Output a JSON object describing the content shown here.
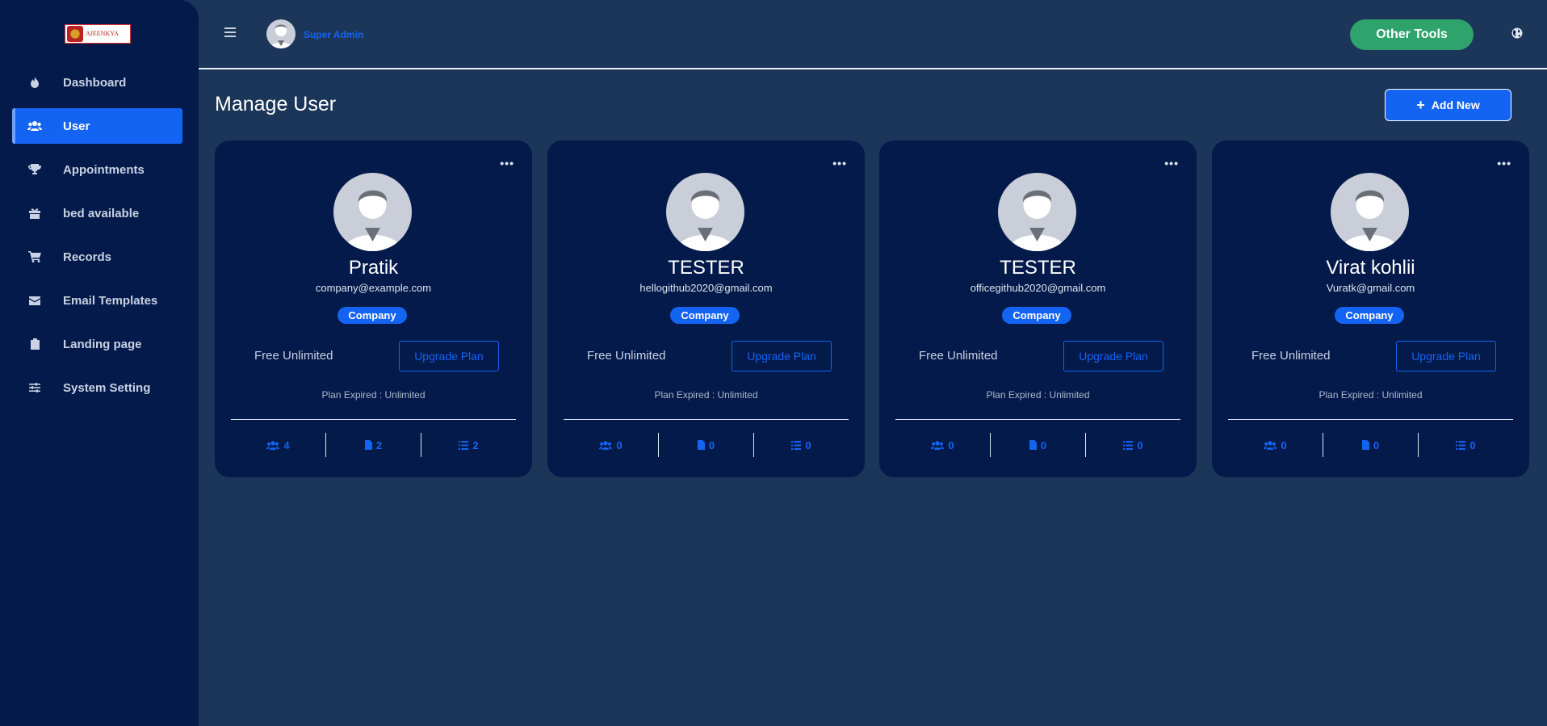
{
  "sidebar": {
    "logo_text": "AJEENKYA",
    "items": [
      {
        "label": "Dashboard",
        "icon": "fire-icon"
      },
      {
        "label": "User",
        "icon": "users-icon"
      },
      {
        "label": "Appointments",
        "icon": "trophy-icon"
      },
      {
        "label": "bed available",
        "icon": "gift-icon"
      },
      {
        "label": "Records",
        "icon": "cart-icon"
      },
      {
        "label": "Email Templates",
        "icon": "envelope-icon"
      },
      {
        "label": "Landing page",
        "icon": "clipboard-icon"
      },
      {
        "label": "System Setting",
        "icon": "sliders-icon"
      }
    ],
    "active_item": "User"
  },
  "header": {
    "user_name": "Super Admin",
    "tools_label": "Other Tools"
  },
  "main": {
    "title": "Manage User",
    "add_label": "Add New",
    "cards": [
      {
        "name": "Pratik",
        "email": "company@example.com",
        "role": "Company",
        "plan": "Free Unlimited",
        "upgrade": "Upgrade Plan",
        "expired": "Plan Expired : Unlimited",
        "users": "4",
        "docs": "2",
        "lists": "2"
      },
      {
        "name": "TESTER",
        "email": "hellogithub2020@gmail.com",
        "role": "Company",
        "plan": "Free Unlimited",
        "upgrade": "Upgrade Plan",
        "expired": "Plan Expired : Unlimited",
        "users": "0",
        "docs": "0",
        "lists": "0"
      },
      {
        "name": "TESTER",
        "email": "officegithub2020@gmail.com",
        "role": "Company",
        "plan": "Free Unlimited",
        "upgrade": "Upgrade Plan",
        "expired": "Plan Expired : Unlimited",
        "users": "0",
        "docs": "0",
        "lists": "0"
      },
      {
        "name": "Virat kohlii",
        "email": "Vuratk@gmail.com",
        "role": "Company",
        "plan": "Free Unlimited",
        "upgrade": "Upgrade Plan",
        "expired": "Plan Expired : Unlimited",
        "users": "0",
        "docs": "0",
        "lists": "0"
      }
    ]
  },
  "colors": {
    "sidebar_bg": "#031a4a",
    "page_bg": "#1b3658",
    "accent": "#1464f4",
    "tools_green": "#2ea36b"
  }
}
